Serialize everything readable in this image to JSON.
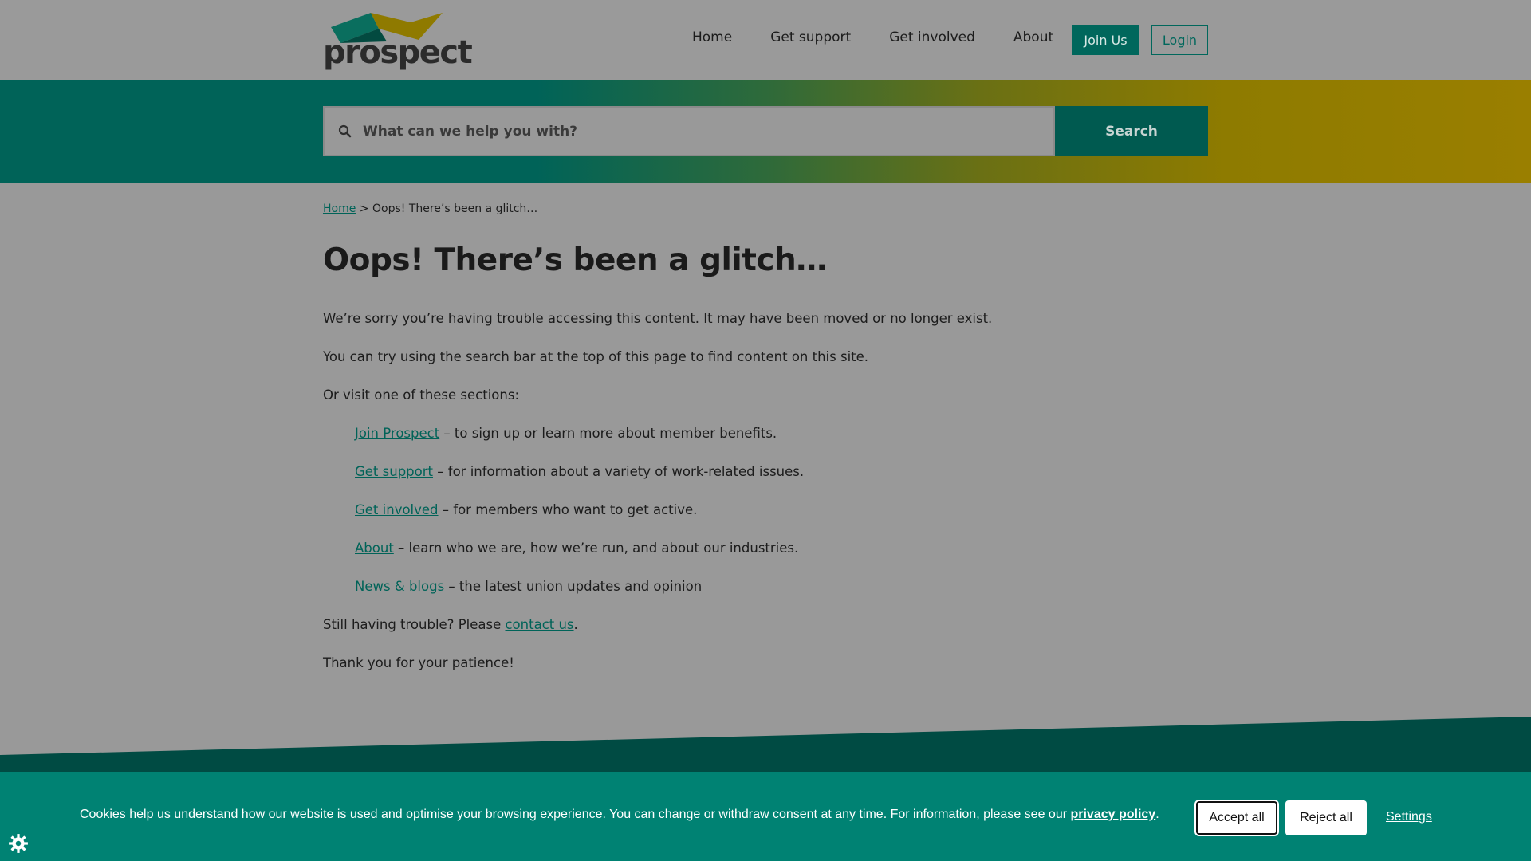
{
  "brand": {
    "name": "prospect"
  },
  "nav": {
    "items": [
      {
        "label": "Home"
      },
      {
        "label": "Get support"
      },
      {
        "label": "Get involved"
      },
      {
        "label": "About"
      }
    ],
    "join_label": "Join Us",
    "login_label": "Login"
  },
  "search": {
    "placeholder": "What can we help you with?",
    "button_label": "Search"
  },
  "breadcrumb": {
    "home": "Home",
    "separator": ">",
    "current": "Oops! There’s been a glitch…"
  },
  "main": {
    "title": "Oops! There’s been a glitch…",
    "p1": "We’re sorry you’re having trouble accessing this content. It may have been moved or no longer exist.",
    "p2": "You can try using the search bar at the top of this page to find content on this site.",
    "p3": "Or visit one of these sections:",
    "sections": [
      {
        "link": "Join Prospect",
        "desc": " –  to sign up or learn more about member benefits."
      },
      {
        "link": "Get support",
        "desc": " –  for information about a variety of work-related issues."
      },
      {
        "link": "Get involved",
        "desc": " –  for members who want to get active."
      },
      {
        "link": "About",
        "desc": " –  learn who we are, how we’re run, and about our industries."
      },
      {
        "link": "News & blogs",
        "desc": " – the latest union updates and opinion"
      }
    ],
    "trouble_prefix": "Still having trouble? Please ",
    "contact_link": "contact us",
    "trouble_suffix": ".",
    "thanks": "Thank you for your patience!"
  },
  "cookie": {
    "text": "Cookies help us understand how our website is used and optimise your browsing experience. You can change or withdraw consent at any time. For information, please see our ",
    "policy_link": "privacy policy",
    "text_end": ".",
    "accept_label": "Accept all",
    "reject_label": "Reject all",
    "settings_label": "Settings"
  },
  "colors": {
    "brand_teal": "#006358",
    "brand_gold": "#9a7f00",
    "cookie_bg": "#008273",
    "page_overlay": "#999999"
  },
  "icons": {
    "search": "search-icon",
    "cookie_settings": "gear-icon",
    "logo": "prospect-logo"
  }
}
